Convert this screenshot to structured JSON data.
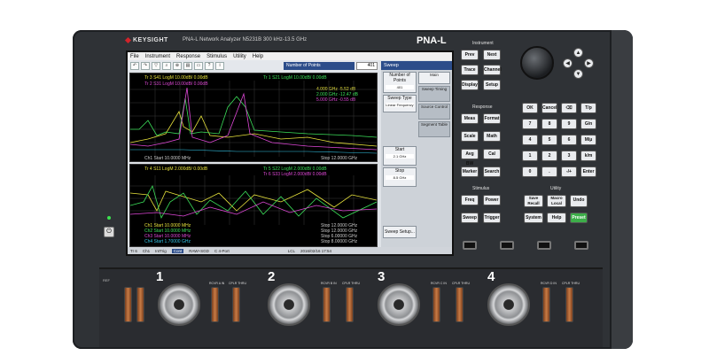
{
  "brand": {
    "name": "KEYSIGHT",
    "model": "PNA-L Network Analyzer   N5231B   300 kHz-13.5 GHz",
    "badge": "PNA-L"
  },
  "menu": [
    "File",
    "Instrument",
    "Response",
    "Stimulus",
    "Utility",
    "Help"
  ],
  "toolbar": {
    "icons": [
      "undo-icon",
      "redo-icon",
      "marker-icon",
      "search-icon",
      "zoom-icon",
      "print-icon",
      "folder-icon",
      "help-icon",
      "info-icon"
    ],
    "number_of_points_label": "Number of Points",
    "number_of_points_value": "401"
  },
  "plot1": {
    "traces": [
      "Tr 3  S41 LogM 10.00dB/ 0.00dB",
      "Tr 1  S21 LogM 10.00dB/ 0.00dB",
      "Tr 2  S31 LogM 10.00dB/ 0.00dB"
    ],
    "markers": [
      "4.000  GHz   -5.52 dB",
      "2.000  GHz   -12.47 dB",
      "5.000  GHz   -0.55 dB"
    ],
    "footer_left": "Ch1  Start  10.0000 MHz",
    "footer_right": "Stop  12.0000 GHz"
  },
  "plot2": {
    "traces": [
      "Tr 4  S11 LogM 2.000dB/ 0.00dB",
      "Tr 5  S22 LogM 2.000dB/ 0.00dB",
      "Tr 6  S33 LogM 2.000dB/ 0.00dB"
    ],
    "footer_rows": [
      "Ch1  Start  10.0000 MHz",
      "Ch2  Start  10.0000 MHz",
      "Ch3  Start  10.0000 MHz",
      "Ch4  Start  1.70000 GHz"
    ],
    "footer_right": [
      "Stop  12.0000 GHz",
      "Stop  12.0000 GHz",
      "Stop  6.00000 GHz",
      "Stop  8.00000 GHz"
    ]
  },
  "statusbar": [
    "Tr 6",
    "Ch1",
    "IntTrig",
    "Cont",
    "RAW+SGD",
    "C 4-Port",
    "LCL",
    "2016/02/16 17:54"
  ],
  "side_panel": {
    "title": "Sweep",
    "buttons": [
      "Number of Points",
      "Sweep Type",
      "Start",
      "Stop",
      "Sweep Setup..."
    ],
    "values": [
      "401",
      "Linear Frequency",
      "2.1 GHz",
      "8.5 GHz",
      ""
    ],
    "tabs": [
      "Main",
      "Sweep Timing",
      "Source Control",
      "Segment Table"
    ]
  },
  "keypad": {
    "groups": [
      "Instrument",
      "Response",
      "Stimulus",
      "Utility"
    ],
    "instrument_keys": [
      "Prev",
      "Next",
      "Trace",
      "Channel",
      "Display",
      "Setup"
    ],
    "response_keys": [
      "Meas",
      "Format",
      "Scale",
      "Math",
      "Avg BW",
      "Cal",
      "Marker",
      "Search"
    ],
    "stimulus_keys": [
      "Freq",
      "Power",
      "Sweep",
      "Trigger"
    ],
    "utility_keys": [
      "Save Recall",
      "Macro Local",
      "Undo",
      "System",
      "Help",
      "Preset"
    ],
    "numeric_keys": [
      "OK",
      "Cancel",
      "⌫",
      "T/p",
      "7",
      "8",
      "9",
      "G/n",
      "4",
      "5",
      "6",
      "M/μ",
      "1",
      "2",
      "3",
      "k/m",
      "0",
      ".",
      "-/+",
      "Enter"
    ]
  },
  "ports": [
    {
      "number": "1",
      "tag_l": "REF",
      "tag_a": "RCVR A IN",
      "tag_b": "CPLR THRU"
    },
    {
      "number": "2",
      "tag_l": "RCVR B IN",
      "tag_a": "RCVR B IN",
      "tag_b": "CPLR THRU"
    },
    {
      "number": "3",
      "tag_l": "RCVR C IN",
      "tag_a": "RCVR C IN",
      "tag_b": "CPLR THRU"
    },
    {
      "number": "4",
      "tag_l": "RCVR D IN",
      "tag_a": "RCVR D IN",
      "tag_b": "CPLR THRU"
    }
  ],
  "colors": {
    "trace_yellow": "#e8e33c",
    "trace_green": "#3ce05a",
    "trace_magenta": "#e048d8",
    "trace_cyan": "#34c6e8",
    "brand_red": "#d2232a",
    "preset_green": "#3cae49"
  }
}
